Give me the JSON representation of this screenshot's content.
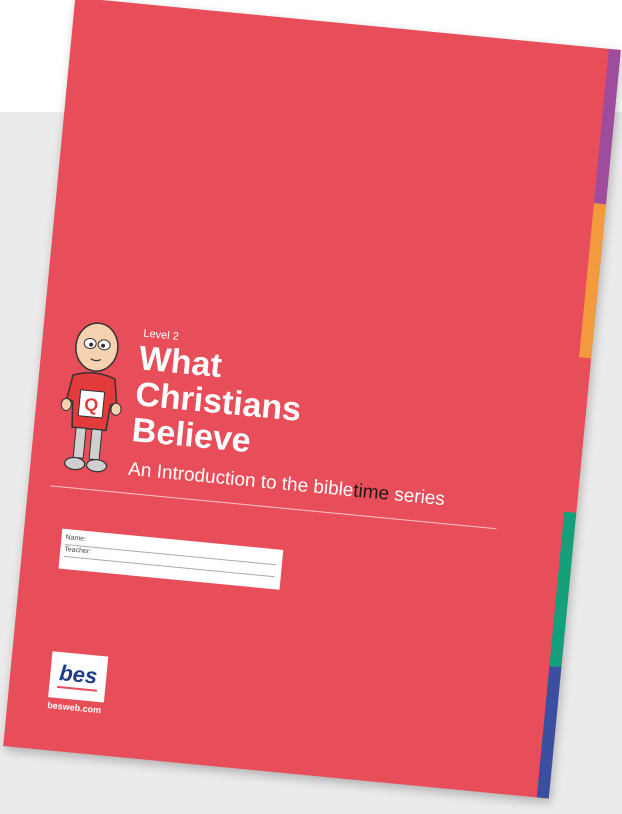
{
  "cover": {
    "level": "Level 2",
    "title_lines": [
      "What",
      "Christians",
      "Believe"
    ],
    "subtitle_before": "An Introduction to the bible",
    "subtitle_highlight": "time",
    "subtitle_after": " series",
    "name_label": "Name:",
    "teacher_label": "Teacher:",
    "logo_text": "bes",
    "website": "besweb.com",
    "character_letter": "Q"
  },
  "colors": {
    "cover": "#e84d5a",
    "tab_purple": "#9d4c9e",
    "tab_orange": "#f39a3c",
    "tab_green": "#13a07a",
    "tab_blue": "#3a4fa0",
    "logo_blue": "#1f3c8c"
  }
}
